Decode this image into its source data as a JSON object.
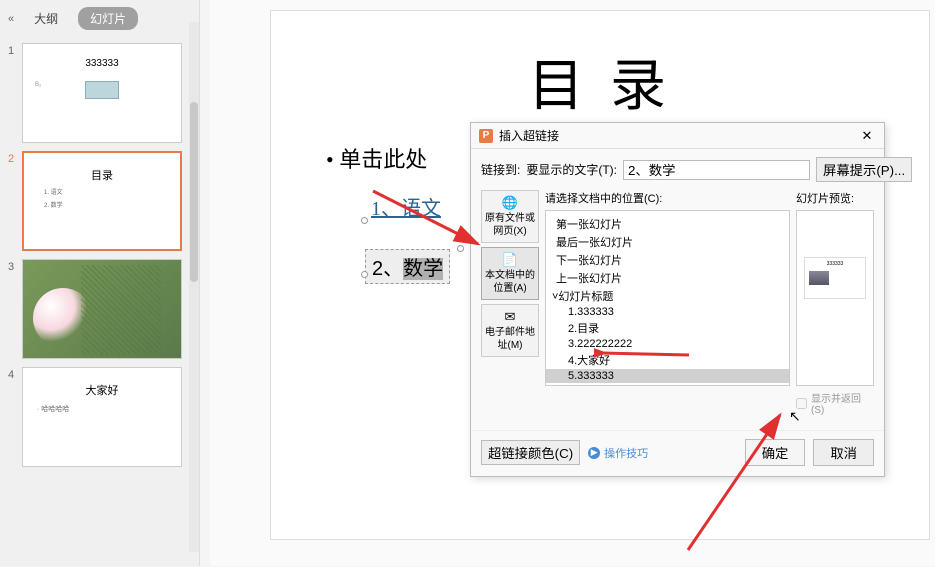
{
  "sidebar": {
    "tab_outline": "大纲",
    "tab_slides": "幻灯片",
    "thumbs": [
      {
        "num": "1",
        "title": "333333",
        "sub": "B₂"
      },
      {
        "num": "2",
        "title": "目录",
        "item1": "1. 语文",
        "item2": "2. 数学"
      },
      {
        "num": "3"
      },
      {
        "num": "4",
        "title": "大家好",
        "sub": "· 哈哈哈哈"
      }
    ]
  },
  "slide": {
    "title": "目 录",
    "bullet": "• 单击此处",
    "link1": "1、语文",
    "link2_prefix": "2、",
    "link2_sel": "数学"
  },
  "dialog": {
    "title": "插入超链接",
    "link_to_label": "链接到:",
    "display_text_label": "要显示的文字(T):",
    "display_text_value": "2、数学",
    "screentip_btn": "屏幕提示(P)...",
    "link_to_options": [
      "原有文件或网页(X)",
      "本文档中的位置(A)",
      "电子邮件地址(M)"
    ],
    "select_pos_label": "请选择文档中的位置(C):",
    "preview_label": "幻灯片预览:",
    "tree": [
      {
        "label": "第一张幻灯片",
        "lvl": "lvl1"
      },
      {
        "label": "最后一张幻灯片",
        "lvl": "lvl1"
      },
      {
        "label": "下一张幻灯片",
        "lvl": "lvl1"
      },
      {
        "label": "上一张幻灯片",
        "lvl": "lvl1"
      },
      {
        "label": "˅幻灯片标题",
        "lvl": "lvl1b"
      },
      {
        "label": "1.333333",
        "lvl": "lvl2"
      },
      {
        "label": "2.目录",
        "lvl": "lvl2"
      },
      {
        "label": "3.222222222",
        "lvl": "lvl2"
      },
      {
        "label": "4.大家好",
        "lvl": "lvl2"
      },
      {
        "label": "5.333333",
        "lvl": "lvl2",
        "selected": true
      }
    ],
    "preview_thumb_title": "333333",
    "show_return": "显示并返回(S)",
    "hyperlink_color_btn": "超链接颜色(C)",
    "op_tips": "操作技巧",
    "ok_btn": "确定",
    "cancel_btn": "取消"
  }
}
